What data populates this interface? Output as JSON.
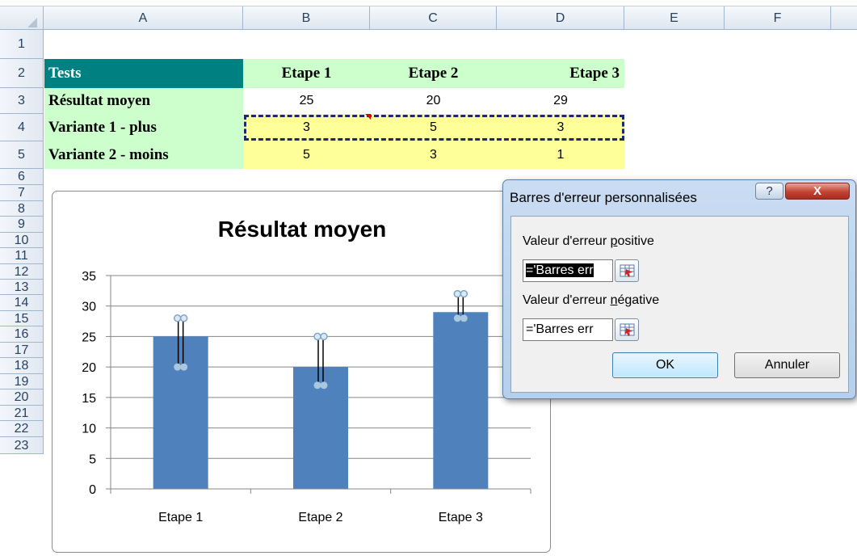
{
  "spreadsheet": {
    "columns": [
      "A",
      "B",
      "C",
      "D",
      "E",
      "F"
    ],
    "rows": [
      "1",
      "2",
      "3",
      "4",
      "5",
      "6",
      "7",
      "8",
      "9",
      "10",
      "11",
      "12",
      "13",
      "14",
      "15",
      "16",
      "17",
      "18",
      "19",
      "20",
      "21",
      "22",
      "23"
    ],
    "header_row": {
      "a": "Tests",
      "b": "Etape 1",
      "c": "Etape 2",
      "d": "Etape 3"
    },
    "row3": {
      "a": "Résultat moyen",
      "b": "25",
      "c": "20",
      "d": "29"
    },
    "row4": {
      "a": "Variante 1 - plus",
      "b": "3",
      "c": "5",
      "d": "3"
    },
    "row5": {
      "a": "Variante 2 - moins",
      "b": "5",
      "c": "3",
      "d": "1"
    },
    "colors": {
      "header_teal": "#008080",
      "green_fill": "#ccffcc",
      "yellow_fill": "#ffff99",
      "grid_header": "#dde6f0"
    }
  },
  "chart_data": {
    "type": "bar",
    "title": "Résultat moyen",
    "categories": [
      "Etape 1",
      "Etape 2",
      "Etape 3"
    ],
    "series": [
      {
        "values": [
          25,
          20,
          29
        ],
        "color": "#4f81bd",
        "error_plus": [
          3,
          5,
          3
        ],
        "error_minus": [
          5,
          3,
          1
        ]
      }
    ],
    "ylim": [
      0,
      35
    ],
    "yticks": [
      "0",
      "5",
      "10",
      "15",
      "20",
      "25",
      "30",
      "35"
    ],
    "grid": true,
    "legend": "none"
  },
  "dialog": {
    "title": "Barres d'erreur personnalisées",
    "help": "?",
    "close": "X",
    "positive_label_pre": "Valeur d'erreur ",
    "positive_label_key": "p",
    "positive_label_post": "ositive",
    "positive_value": "='Barres err",
    "negative_label_pre": "Valeur d'erreur ",
    "negative_label_key": "n",
    "negative_label_post": "égative",
    "negative_value": "='Barres err",
    "ok": "OK",
    "cancel": "Annuler"
  }
}
